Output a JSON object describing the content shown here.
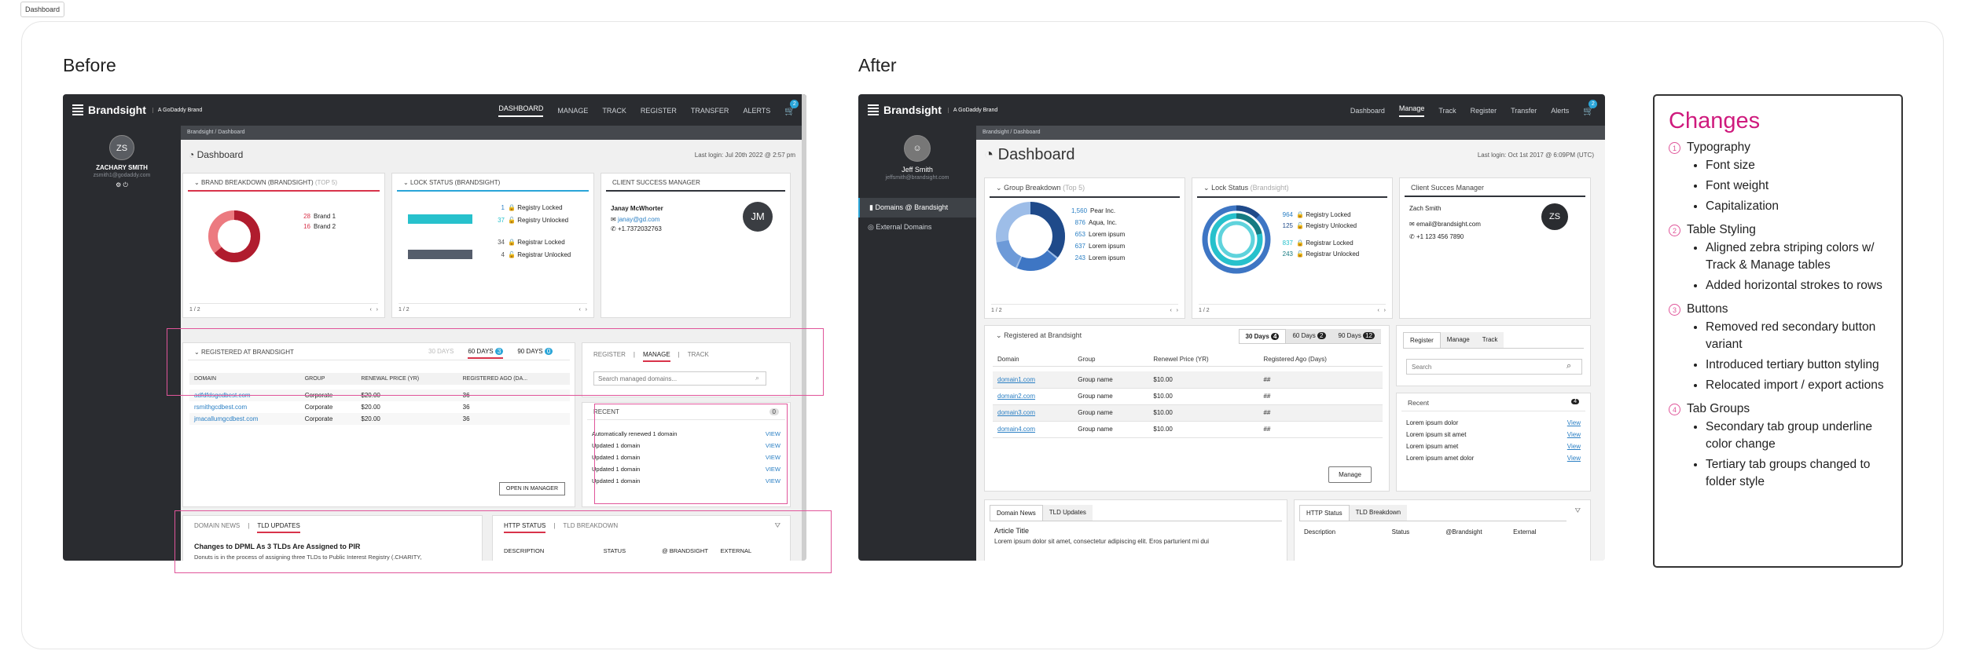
{
  "tag": "Dashboard",
  "labels": {
    "before": "Before",
    "after": "After"
  },
  "before": {
    "logo": "Brandsight",
    "logo_sub": "A GoDaddy Brand",
    "nav": [
      "DASHBOARD",
      "MANAGE",
      "TRACK",
      "REGISTER",
      "TRANSFER",
      "ALERTS"
    ],
    "cart_count": "2",
    "user": {
      "initials": "ZS",
      "name": "ZACHARY SMITH",
      "email": "zsmith1@godaddy.com"
    },
    "breadcrumb": "Brandsight  /  Dashboard",
    "title": "Dashboard",
    "last_login": "Last login: Jul 20th 2022 @ 2:57 pm",
    "brand": {
      "title": "BRAND BREAKDOWN (BRANDSIGHT)",
      "top": "(TOP 5)",
      "items": [
        {
          "n": "28",
          "label": "Brand 1"
        },
        {
          "n": "16",
          "label": "Brand 2"
        }
      ],
      "pager": "1 / 2"
    },
    "lock": {
      "title": "LOCK STATUS (BRANDSIGHT)",
      "items": [
        {
          "n": "1",
          "label": "Registry Locked"
        },
        {
          "n": "37",
          "label": "Registry Unlocked"
        },
        {
          "n": "34",
          "label": "Registrar Locked"
        },
        {
          "n": "4",
          "label": "Registrar Unlocked"
        }
      ],
      "pager": "1 / 2"
    },
    "csm": {
      "title": "CLIENT SUCCESS MANAGER",
      "name": "Janay McWhorter",
      "email": "janay@gd.com",
      "phone": "+1.7372032763",
      "initials": "JM"
    },
    "registered": {
      "title": "REGISTERED AT BRANDSIGHT",
      "tabs": [
        "30 DAYS",
        "60 DAYS",
        "90 DAYS"
      ],
      "counts": [
        "",
        "3",
        "0"
      ],
      "columns": [
        "DOMAIN",
        "GROUP",
        "RENEWAL PRICE (YR)",
        "REGISTERED AGO (DA..."
      ],
      "rows": [
        [
          "adfdfdsgcdbest.com",
          "Corporate",
          "$20.00",
          "36"
        ],
        [
          "rsmithgcdbest.com",
          "Corporate",
          "$20.00",
          "36"
        ],
        [
          "jmacallumgcdbest.com",
          "Corporate",
          "$20.00",
          "36"
        ]
      ],
      "button": "OPEN IN MANAGER"
    },
    "manage": {
      "tabs": [
        "REGISTER",
        "MANAGE",
        "TRACK"
      ],
      "placeholder": "Search managed domains..."
    },
    "recent": {
      "title": "RECENT",
      "count": "0",
      "items": [
        "Automatically renewed 1 domain",
        "Updated 1 domain",
        "Updated 1 domain",
        "Updated 1 domain",
        "Updated 1 domain"
      ],
      "view": "VIEW"
    },
    "news": {
      "tabs": [
        "DOMAIN NEWS",
        "TLD UPDATES"
      ],
      "headline": "Changes to DPML As 3 TLDs Are Assigned to PIR",
      "body": "Donuts is in the process of assigning three TLDs to Public Interest Registry (.CHARITY,"
    },
    "http": {
      "tabs": [
        "HTTP STATUS",
        "TLD BREAKDOWN"
      ],
      "columns": [
        "DESCRIPTION",
        "STATUS",
        "@ BRANDSIGHT",
        "EXTERNAL"
      ]
    }
  },
  "after": {
    "logo": "Brandsight",
    "logo_sub": "A GoDaddy Brand",
    "nav": [
      "Dashboard",
      "Manage",
      "Track",
      "Register",
      "Transfer",
      "Alerts"
    ],
    "cart_count": "2",
    "user": {
      "name": "Jeff Smith",
      "email": "jeffsmith@brandsight.com"
    },
    "side": [
      "Domains @ Brandsight",
      "External Domains"
    ],
    "breadcrumb": "Brandsight  /  Dashboard",
    "title": "Dashboard",
    "last_login": "Last login: Oct 1st 2017 @ 6:09PM (UTC)",
    "group": {
      "title": "Group Breakdown",
      "top": "(Top 5)",
      "items": [
        {
          "n": "1,560",
          "label": "Pear Inc."
        },
        {
          "n": "876",
          "label": "Aqua, Inc."
        },
        {
          "n": "653",
          "label": "Lorem ipsum"
        },
        {
          "n": "637",
          "label": "Lorem ipsum"
        },
        {
          "n": "243",
          "label": "Lorem ipsum"
        }
      ],
      "pager": "1 / 2"
    },
    "lock": {
      "title": "Lock Status",
      "sub": "(Brandsight)",
      "items": [
        {
          "n": "964",
          "label": "Registry Locked"
        },
        {
          "n": "125",
          "label": "Registry Unlocked"
        },
        {
          "n": "837",
          "label": "Registrar Locked"
        },
        {
          "n": "243",
          "label": "Registrar Unlocked"
        }
      ],
      "pager": "1 / 2"
    },
    "csm": {
      "title": "Client Succes Manager",
      "name": "Zach Smith",
      "email": "email@brandsight.com",
      "phone": "+1 123 456 7890",
      "initials": "ZS"
    },
    "registered": {
      "title": "Registered at Brandsight",
      "tabs": [
        "30 Days",
        "60 Days",
        "90 Days"
      ],
      "counts": [
        "4",
        "2",
        "12"
      ],
      "columns": [
        "Domain",
        "Group",
        "Renewel Price (YR)",
        "Registered Ago (Days)"
      ],
      "rows": [
        [
          "domain1.com",
          "Group name",
          "$10.00",
          "##"
        ],
        [
          "domain2.com",
          "Group name",
          "$10.00",
          "##"
        ],
        [
          "domain3.com",
          "Group name",
          "$10.00",
          "##"
        ],
        [
          "domain4.com",
          "Group name",
          "$10.00",
          "##"
        ]
      ],
      "button": "Manage"
    },
    "manage": {
      "tabs": [
        "Register",
        "Manage",
        "Track"
      ],
      "placeholder": "Search"
    },
    "recent": {
      "title": "Recent",
      "count": "4",
      "items": [
        "Lorem ipsum dolor",
        "Lorem ipsum sit amet",
        "Lorem ipsum amet",
        "Lorem ipsum amet dolor"
      ],
      "view": "View"
    },
    "news": {
      "tabs": [
        "Domain News",
        "TLD Updates"
      ],
      "headline": "Article Title",
      "body": "Lorem ipsum dolor sit amet, consectetur adipiscing elit. Eros parturient mi dui"
    },
    "http": {
      "tabs": [
        "HTTP Status",
        "TLD Breakdown"
      ],
      "columns": [
        "Description",
        "Status",
        "@Brandsight",
        "External"
      ]
    }
  },
  "changes": {
    "title": "Changes",
    "sections": [
      {
        "num": "1",
        "title": "Typography",
        "items": [
          "Font size",
          "Font weight",
          "Capitalization"
        ]
      },
      {
        "num": "2",
        "title": "Table Styling",
        "items": [
          "Aligned zebra striping colors w/ Track & Manage tables",
          "Added horizontal strokes to rows"
        ]
      },
      {
        "num": "3",
        "title": "Buttons",
        "items": [
          "Removed red secondary button variant",
          "Introduced tertiary button styling",
          "Relocated import / export actions"
        ]
      },
      {
        "num": "4",
        "title": "Tab Groups",
        "items": [
          "Secondary tab group underline color change",
          "Tertiary tab groups changed to folder style"
        ]
      }
    ]
  }
}
